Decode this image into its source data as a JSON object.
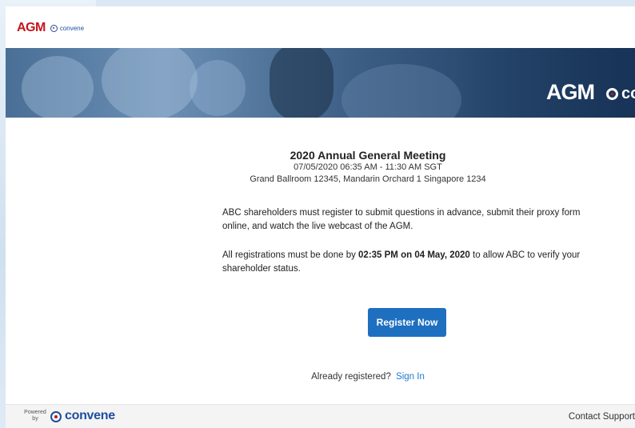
{
  "header": {
    "logo_agm": "AGM",
    "logo_convene": "convene"
  },
  "banner": {
    "agm_text": "AGM",
    "convene_partial": "co"
  },
  "meeting": {
    "title": "2020 Annual General Meeting",
    "datetime": "07/05/2020 06:35 AM - 11:30 AM SGT",
    "venue": "Grand Ballroom 12345, Mandarin Orchard 1 Singapore 1234"
  },
  "info": {
    "paragraph1": "ABC shareholders must register to submit questions in advance, submit their proxy form online, and watch the live webcast of the AGM.",
    "paragraph2_prefix": "All registrations must be done by ",
    "paragraph2_deadline": "02:35 PM on 04 May, 2020",
    "paragraph2_suffix": " to allow ABC to verify your shareholder status."
  },
  "actions": {
    "register_label": "Register Now",
    "already_text": "Already registered?",
    "signin_label": "Sign In"
  },
  "footer": {
    "powered_by": "Powered by",
    "brand": "convene",
    "contact_support": "Contact Support"
  },
  "colors": {
    "agm_red": "#c4161c",
    "convene_blue": "#1e4fa0",
    "button_blue": "#1e6fc0",
    "link_blue": "#1e7bd0"
  }
}
